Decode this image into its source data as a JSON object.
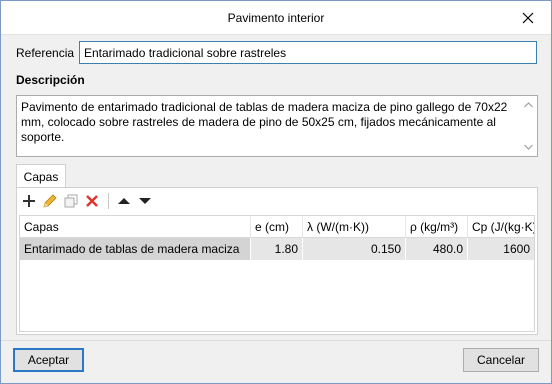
{
  "window": {
    "title": "Pavimento interior"
  },
  "reference": {
    "label": "Referencia",
    "value": "Entarimado tradicional sobre rastreles"
  },
  "description": {
    "label": "Descripción",
    "text": "Pavimento de entarimado tradicional de tablas de madera maciza de pino gallego de 70x22 mm, colocado sobre rastreles de madera de pino de 50x25 cm, fijados mecánicamente al soporte."
  },
  "tabs": [
    {
      "label": "Capas"
    }
  ],
  "toolbar": {
    "icons": [
      "add-icon",
      "edit-icon",
      "copy-icon",
      "delete-icon",
      "move-up-icon",
      "move-down-icon"
    ],
    "colors": {
      "delete": "#e0332b",
      "edit": "#e8a317",
      "add": "#333333"
    }
  },
  "grid": {
    "columns": [
      "Capas",
      "e (cm)",
      "λ (W/(m·K))",
      "ρ (kg/m³)",
      "Cp (J/(kg·K))"
    ],
    "rows": [
      [
        "Entarimado de tablas de madera maciza",
        "1.80",
        "0.150",
        "480.0",
        "1600"
      ]
    ]
  },
  "buttons": {
    "accept": "Aceptar",
    "cancel": "Cancelar"
  },
  "colors": {
    "accent": "#2b78c4",
    "window_border": "#7a9cc4"
  }
}
